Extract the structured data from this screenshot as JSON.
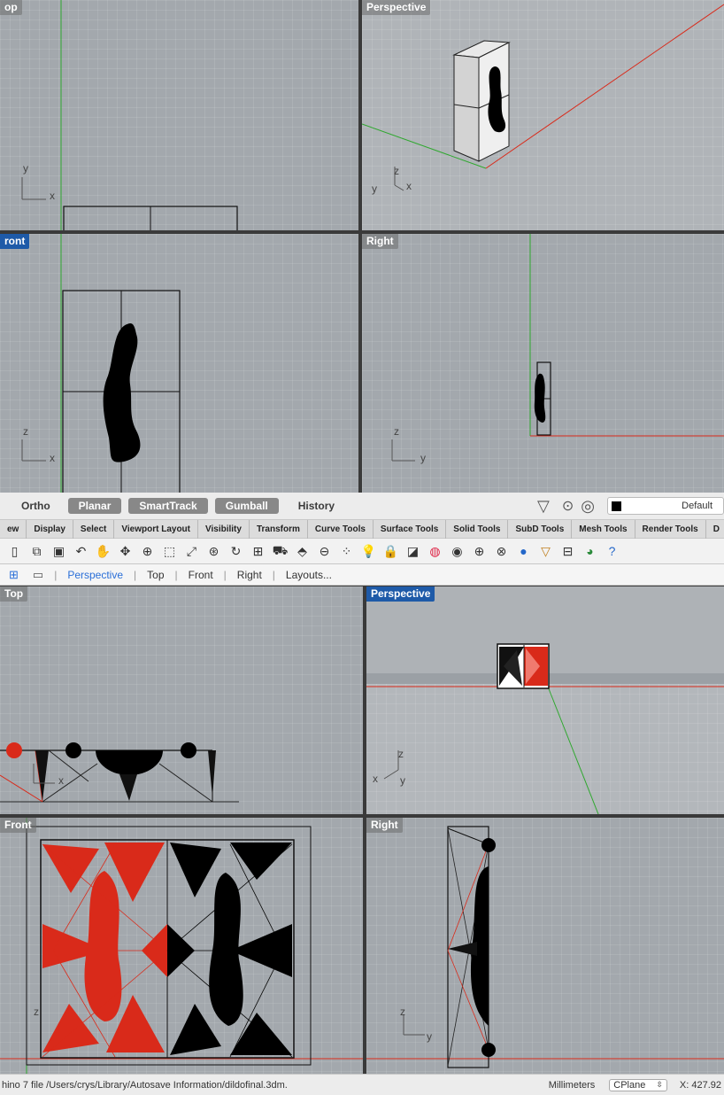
{
  "upper": {
    "viewports": {
      "top": {
        "label": "op",
        "axis_y": "y",
        "axis_x": "x"
      },
      "perspective": {
        "label": "Perspective",
        "axis_z": "z",
        "axis_y": "y",
        "axis_x": "x"
      },
      "front": {
        "label": "ront",
        "axis_z": "z",
        "axis_x": "x"
      },
      "right": {
        "label": "Right",
        "axis_z": "z",
        "axis_y": "y"
      }
    }
  },
  "statusbar": {
    "ortho": "Ortho",
    "planar": "Planar",
    "smarttrack": "SmartTrack",
    "gumball": "Gumball",
    "history": "History",
    "layer": "Default"
  },
  "tabs": [
    "ew",
    "Display",
    "Select",
    "Viewport Layout",
    "Visibility",
    "Transform",
    "Curve Tools",
    "Surface Tools",
    "Solid Tools",
    "SubD Tools",
    "Mesh Tools",
    "Render Tools",
    "D"
  ],
  "icons": [
    "new-view-icon",
    "copy-icon",
    "paste-icon",
    "undo-icon",
    "pan-icon",
    "rotate-view-icon",
    "zoom-icon",
    "zoom-window-icon",
    "zoom-extents-icon",
    "zoom-selected-icon",
    "rotate-camera-icon",
    "four-viewports-icon",
    "car-icon",
    "select-icon",
    "plane-icon",
    "point-icon",
    "light-icon",
    "lock-icon",
    "layer-icon",
    "color-wheel-icon",
    "display-icon",
    "sphere-icon",
    "wire-sphere-icon",
    "render-icon",
    "filter-icon",
    "hierarchy-icon",
    "globe-icon",
    "help-icon"
  ],
  "viewtabs": {
    "perspective": "Perspective",
    "top": "Top",
    "front": "Front",
    "right": "Right",
    "layouts": "Layouts..."
  },
  "lower": {
    "viewports": {
      "top": {
        "label": "Top",
        "axis_x": "x"
      },
      "perspective": {
        "label": "Perspective",
        "axis_z": "z",
        "axis_x": "x",
        "axis_y": "y"
      },
      "front": {
        "label": "Front",
        "axis_z": "z"
      },
      "right": {
        "label": "Right",
        "axis_z": "z",
        "axis_y": "y"
      }
    }
  },
  "bottom": {
    "file": "hino 7 file /Users/crys/Library/Autosave Information/dildofinal.3dm.",
    "units": "Millimeters",
    "cplane": "CPlane",
    "coord": "X: 427.92"
  },
  "colors": {
    "red": "#d92a1a",
    "active": "#1e5aa8",
    "black": "#000000"
  }
}
